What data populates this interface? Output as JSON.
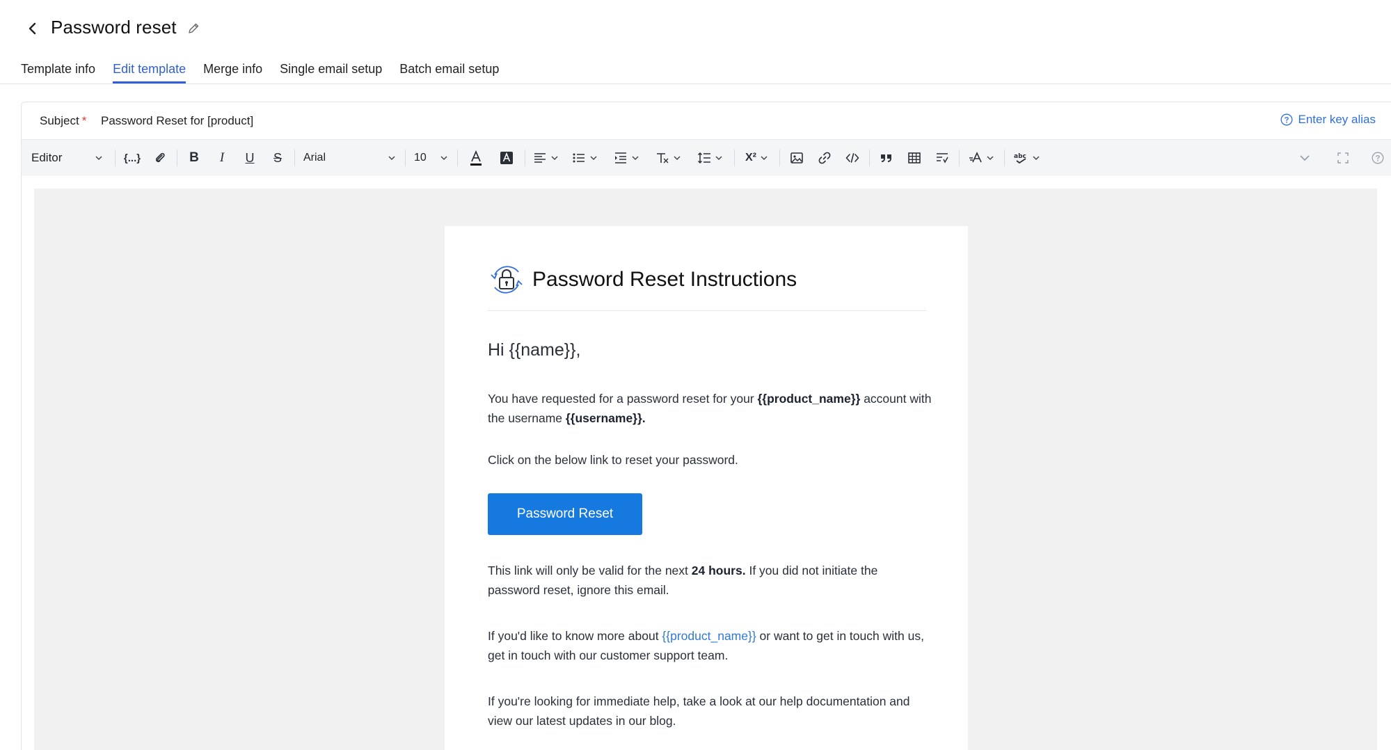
{
  "header": {
    "title": "Password reset"
  },
  "tabs": [
    {
      "label": "Template info"
    },
    {
      "label": "Edit template"
    },
    {
      "label": "Merge info"
    },
    {
      "label": "Single email setup"
    },
    {
      "label": "Batch email setup"
    }
  ],
  "subject": {
    "label": "Subject",
    "required_mark": "*",
    "value": "Password Reset for [product]",
    "alias_link": "Enter key alias"
  },
  "toolbar": {
    "mode": "Editor",
    "merge_tag": "{...}",
    "font": "Arial",
    "font_size": "10"
  },
  "email": {
    "title": "Password Reset Instructions",
    "greeting": "Hi {{name}},",
    "p1_a": "You have requested for a password reset for your ",
    "p1_b": "{{product_name}}",
    "p1_c": " account with the username ",
    "p1_d": "{{username}}.",
    "p2": "Click on the below link to reset your password.",
    "button": "Password Reset",
    "p3_a": "This link will only be valid for the next ",
    "p3_b": "24 hours.",
    "p3_c": " If you did not initiate the password reset, ignore this email.",
    "p4_a": "If you'd like to know more about ",
    "p4_b": "{{product_name}}",
    "p4_c": " or want to get in touch with us, get in touch with our customer support team.",
    "p5": "If you're looking for immediate help, take a look at our help documentation and view our latest updates in our blog."
  }
}
